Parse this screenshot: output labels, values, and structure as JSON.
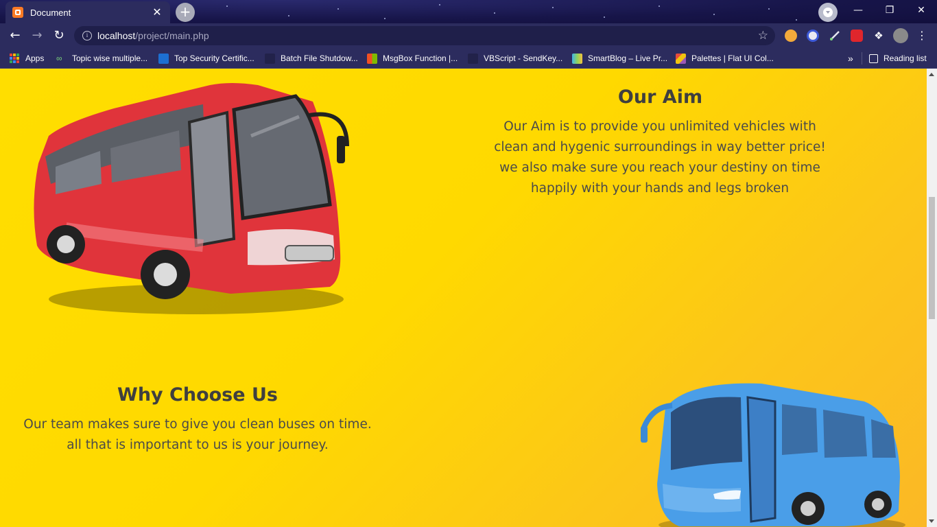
{
  "browser": {
    "tab_title": "Document",
    "url_host": "localhost",
    "url_path": "/project/main.php",
    "new_tab_label": "+",
    "tab_close_label": "✕"
  },
  "bookmarks": [
    {
      "label": "Apps",
      "icon": "apps-grid-icon"
    },
    {
      "label": "Topic wise multiple...",
      "icon": "chain-link-icon"
    },
    {
      "label": "Top Security Certific...",
      "icon": "site-icon"
    },
    {
      "label": "Batch File Shutdow...",
      "icon": "page-icon"
    },
    {
      "label": "MsgBox Function |...",
      "icon": "microsoft-icon"
    },
    {
      "label": "VBScript - SendKey...",
      "icon": "page-icon"
    },
    {
      "label": "SmartBlog – Live Pr...",
      "icon": "smartblog-icon"
    },
    {
      "label": "Palettes | Flat UI Col...",
      "icon": "palette-icon"
    }
  ],
  "bookmarks_overflow": "»",
  "reading_list": "Reading list",
  "aim": {
    "title": "Our Aim",
    "text": "Our Aim is to provide you unlimited vehicles with clean and hygenic surroundings in way better price! we also make sure you reach your destiny on time happily with your hands and legs broken"
  },
  "why": {
    "title": "Why Choose Us",
    "text": "Our team makes sure to give you clean buses on time. all that is important to us is your journey."
  },
  "colors": {
    "page_gradient_start": "#ffde00",
    "page_gradient_end": "#fbb826",
    "heading": "#3f3f3f",
    "red_bus": "#e0343b",
    "blue_bus": "#4a9ee8",
    "browser_frame": "#2c2c5e"
  }
}
